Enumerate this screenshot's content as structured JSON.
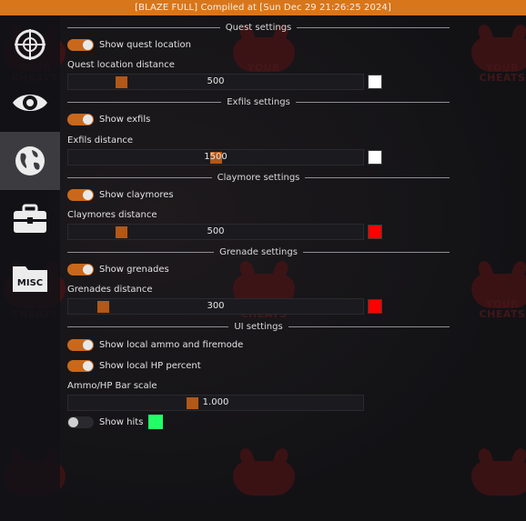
{
  "titlebar": "[BLAZE FULL] Compiled at [Sun Dec 29 21:26:25 2024]",
  "watermark_text": "YOUR CHEATS",
  "sidebar": {
    "tabs": [
      {
        "icon": "crosshair-icon",
        "active": false
      },
      {
        "icon": "eye-icon",
        "active": false
      },
      {
        "icon": "globe-icon",
        "active": true
      },
      {
        "icon": "briefcase-icon",
        "active": false
      },
      {
        "icon": "misc-folder-icon",
        "label": "MISC",
        "active": false
      }
    ]
  },
  "sections": {
    "quest": {
      "title": "Quest settings",
      "toggle_label": "Show quest location",
      "toggle_on": true,
      "distance_label": "Quest location distance",
      "distance_value": "500",
      "swatch_color": "#ffffff"
    },
    "exfils": {
      "title": "Exfils settings",
      "toggle_label": "Show exfils",
      "toggle_on": true,
      "distance_label": "Exfils distance",
      "distance_value": "1500",
      "swatch_color": "#ffffff"
    },
    "claymore": {
      "title": "Claymore settings",
      "toggle_label": "Show claymores",
      "toggle_on": true,
      "distance_label": "Claymores distance",
      "distance_value": "500",
      "swatch_color": "#ff0000"
    },
    "grenade": {
      "title": "Grenade settings",
      "toggle_label": "Show grenades",
      "toggle_on": true,
      "distance_label": "Grenades distance",
      "distance_value": "300",
      "swatch_color": "#ff0000"
    },
    "ui": {
      "title": "UI settings",
      "ammo_label": "Show local ammo and firemode",
      "ammo_on": true,
      "hp_label": "Show local HP percent",
      "hp_on": true,
      "scale_label": "Ammo/HP Bar scale",
      "scale_value": "1.000",
      "hits_label": "Show hits",
      "hits_on": false,
      "hits_color": "#22ff66"
    }
  },
  "colors": {
    "accent": "#d8761b",
    "toggle_on": "#c9681b",
    "slider_grab": "#b25818",
    "active_tab": "#3c3c40"
  }
}
